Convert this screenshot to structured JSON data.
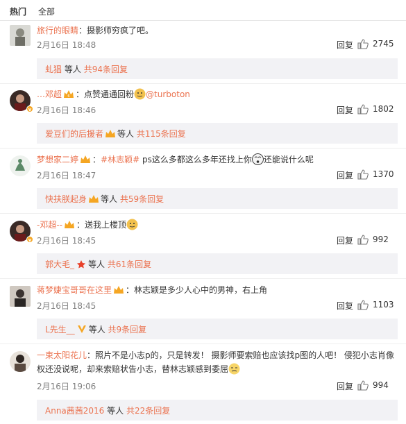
{
  "tabs": {
    "hot": "热门",
    "all": "全部"
  },
  "reply_label": "回复",
  "others_label": "等人",
  "comments": [
    {
      "user": "旅行的眼睛",
      "sep": "：",
      "text": "摄影师穷疯了吧。",
      "date": "2月16日 18:48",
      "likes": "2745",
      "reply_user": "虬猖",
      "reply_count": "共94条回复"
    },
    {
      "user": "…邓超",
      "sep": "：",
      "text": "点赞通通回粉",
      "mention": "@turboton",
      "date": "2月16日 18:46",
      "likes": "1802",
      "reply_user": "爱豆们的后援者",
      "reply_count": "共115条回复"
    },
    {
      "user": "梦想家二婷",
      "sep": "：",
      "mention": "#林志颖#",
      "text": " ps这么多都这么多年还找上你",
      "text2": "还能说什么呢",
      "date": "2月16日 18:47",
      "likes": "1370",
      "reply_user": "快扶朕起身",
      "reply_count": "共59条回复"
    },
    {
      "user": "-邓超--",
      "sep": "：",
      "text": "送我上楼顶",
      "date": "2月16日 18:45",
      "likes": "992",
      "reply_user": "郭大毛_",
      "reply_count": "共61条回复"
    },
    {
      "user": "蒋梦婕宝哥哥在这里",
      "sep": "：",
      "text": "林志颖是多少人心中的男神，右上角",
      "date": "2月16日 18:45",
      "likes": "1103",
      "reply_user": "L先生__",
      "reply_count": "共9条回复"
    },
    {
      "user": "一束太阳花儿",
      "sep": "：",
      "text": "照片不是小志p的，只是转发！ 摄影师要索赔也应该找p图的人吧！ 侵犯小志肖像权还没说呢，却来索赔状告小志，替林志颖感到委屈",
      "date": "2月16日 19:06",
      "likes": "994",
      "reply_user": "Anna茜茜2016",
      "reply_count": "共22条回复"
    }
  ],
  "colors": {
    "link": "#eb7350",
    "reply_bg": "#f2f2f5",
    "meta": "#808080"
  }
}
